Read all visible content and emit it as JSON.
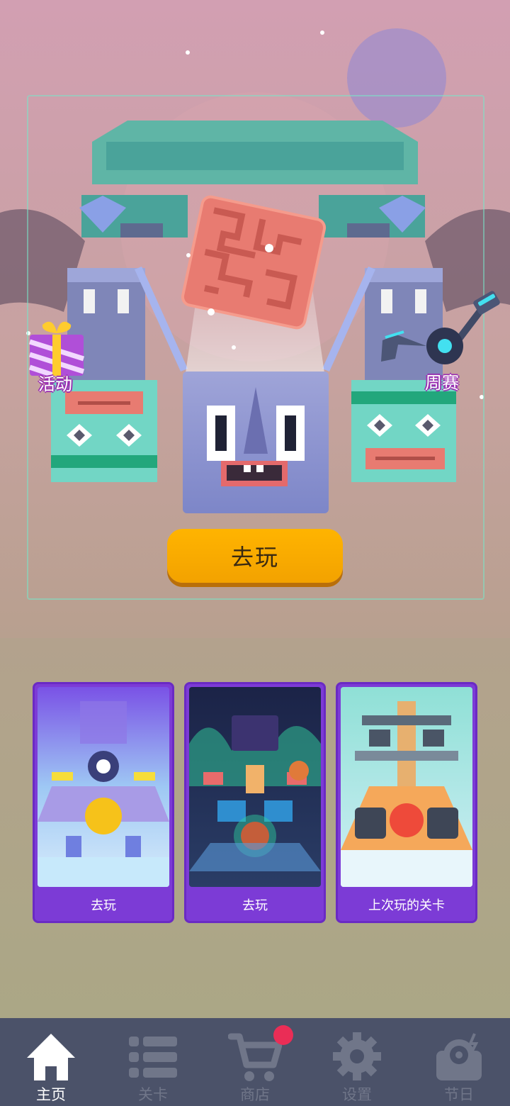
{
  "hero": {
    "play_label": "去玩",
    "left_label": "活动",
    "right_label": "周赛"
  },
  "cards": [
    {
      "label": "去玩",
      "border_color": "#7c3bd6"
    },
    {
      "label": "去玩",
      "border_color": "#7c3bd6"
    },
    {
      "label": "上次玩的关卡",
      "border_color": "#7c3bd6"
    }
  ],
  "nav": {
    "items": [
      {
        "label": "主页",
        "icon": "home-icon",
        "active": true
      },
      {
        "label": "关卡",
        "icon": "list-icon",
        "active": false
      },
      {
        "label": "商店",
        "icon": "cart-icon",
        "active": false
      },
      {
        "label": "设置",
        "icon": "gear-icon",
        "active": false
      },
      {
        "label": "节日",
        "icon": "festival-icon",
        "active": false
      }
    ],
    "badge_on": "商店"
  },
  "colors": {
    "play_button": "#ffb400",
    "card_purple": "#7c3bd6",
    "nav_bg": "#4b5269",
    "nav_active": "#ffffff",
    "nav_inactive": "#707689",
    "badge": "#ea2d56"
  }
}
